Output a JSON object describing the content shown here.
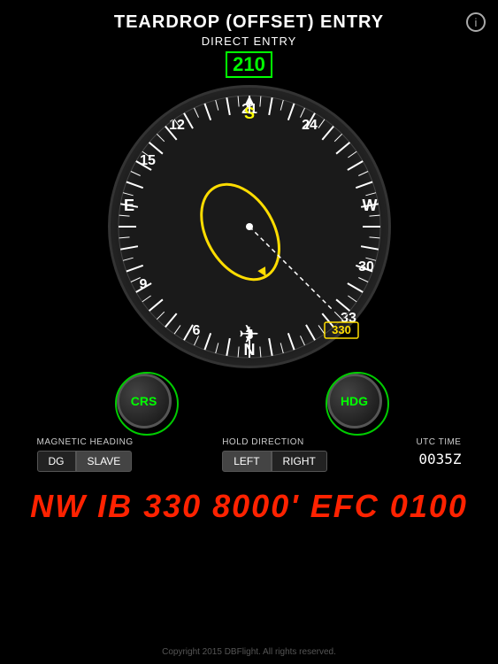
{
  "header": {
    "title": "TEARDROP (OFFSET) ENTRY",
    "subtitle": "DIRECT ENTRY",
    "info_icon": "ⓘ"
  },
  "heading": {
    "value": "210"
  },
  "compass": {
    "labels": [
      "21",
      "24",
      "W",
      "30",
      "33",
      "N",
      "3",
      "6",
      "9",
      "E",
      "15",
      "12",
      "S"
    ],
    "course_value": "330",
    "tick_count": 72
  },
  "knobs": {
    "left": {
      "label": "CRS"
    },
    "right": {
      "label": "HDG"
    }
  },
  "magnetic_heading": {
    "label": "MAGNETIC HEADING",
    "buttons": [
      "DG",
      "SLAVE"
    ],
    "active": "SLAVE"
  },
  "hold_direction": {
    "label": "HOLD DIRECTION",
    "buttons": [
      "LEFT",
      "RIGHT"
    ],
    "active": "LEFT"
  },
  "utc": {
    "label": "UTC TIME",
    "value": "0035Z"
  },
  "clearance": {
    "text": "NW IB 330 8000' EFC 0100"
  },
  "copyright": {
    "text": "Copyright 2015 DBFlight. All rights reserved."
  }
}
